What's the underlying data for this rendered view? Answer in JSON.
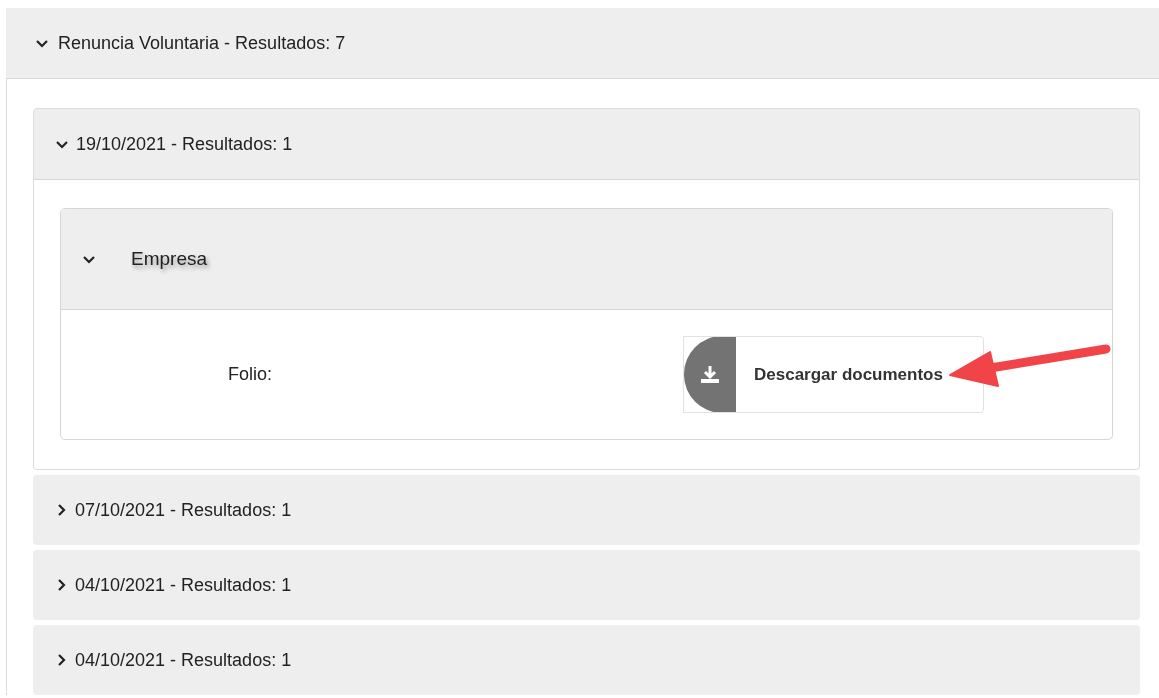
{
  "group": {
    "title": "Renuncia Voluntaria - Resultados: 7",
    "expanded": true,
    "children": [
      {
        "title": "19/10/2021 - Resultados: 1",
        "expanded": true,
        "children": [
          {
            "title": "Empresa",
            "expanded": true,
            "field_label": "Folio:",
            "button": "Descargar documentos"
          }
        ]
      },
      {
        "title": "07/10/2021 - Resultados: 1",
        "expanded": false
      },
      {
        "title": "04/10/2021 - Resultados: 1",
        "expanded": false
      },
      {
        "title": "04/10/2021 - Resultados: 1",
        "expanded": false
      }
    ]
  }
}
